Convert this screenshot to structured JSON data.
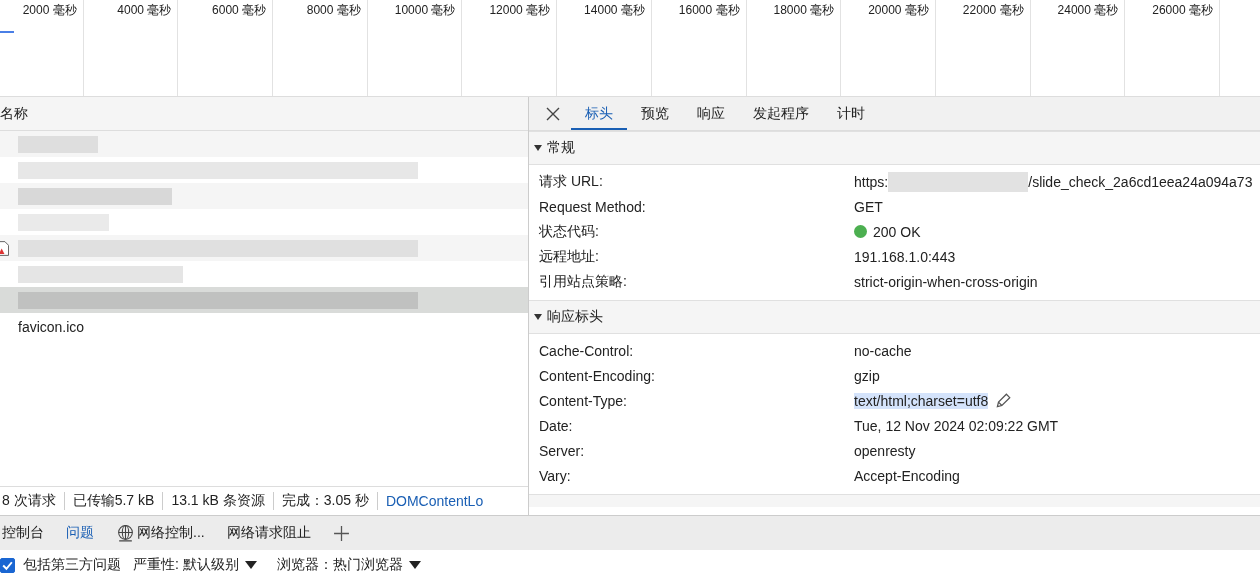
{
  "timeline": {
    "ticks": [
      "2000 毫秒",
      "4000 毫秒",
      "6000 毫秒",
      "8000 毫秒",
      "10000 毫秒",
      "12000 毫秒",
      "14000 毫秒",
      "16000 毫秒",
      "18000 毫秒",
      "20000 毫秒",
      "22000 毫秒",
      "24000 毫秒",
      "26000 毫秒"
    ]
  },
  "requests": {
    "column": "名称",
    "rows": [
      {
        "kind": "redacted",
        "selected": false
      },
      {
        "kind": "redacted",
        "selected": false
      },
      {
        "kind": "redacted",
        "selected": false
      },
      {
        "kind": "redacted",
        "selected": false
      },
      {
        "kind": "redacted_error",
        "selected": false
      },
      {
        "kind": "redacted",
        "selected": false
      },
      {
        "kind": "redacted",
        "selected": true
      },
      {
        "kind": "name",
        "name": "favicon.ico",
        "selected": false
      }
    ]
  },
  "status_bar": [
    {
      "text": "8 次请求",
      "kind": "plain"
    },
    {
      "text": "已传输5.7 kB",
      "kind": "plain"
    },
    {
      "text": "13.1 kB 条资源",
      "kind": "plain"
    },
    {
      "text": "完成：3.05 秒",
      "kind": "plain"
    },
    {
      "text": "DOMContentLo",
      "kind": "link"
    }
  ],
  "detail_tabs": [
    {
      "label": "标头",
      "selected": true
    },
    {
      "label": "预览",
      "selected": false
    },
    {
      "label": "响应",
      "selected": false
    },
    {
      "label": "发起程序",
      "selected": false
    },
    {
      "label": "计时",
      "selected": false
    }
  ],
  "sections": [
    {
      "title": "常规",
      "expanded": true,
      "rows": [
        {
          "name": "请求 URL:",
          "kind": "url",
          "value_prefix": "https:",
          "value": "/slide_check_2a6cd1eea24a094a73"
        },
        {
          "name": "Request Method:",
          "kind": "text",
          "value": "GET"
        },
        {
          "name": "状态代码:",
          "kind": "status",
          "value": "200 OK",
          "color": "#4caf50"
        },
        {
          "name": "远程地址:",
          "kind": "text",
          "value": "191.168.1.0:443"
        },
        {
          "name": "引用站点策略:",
          "kind": "text",
          "value": "strict-origin-when-cross-origin"
        }
      ]
    },
    {
      "title": "响应标头",
      "expanded": true,
      "rows": [
        {
          "name": "Cache-Control:",
          "kind": "text",
          "value": "no-cache"
        },
        {
          "name": "Content-Encoding:",
          "kind": "text",
          "value": "gzip"
        },
        {
          "name": "Content-Type:",
          "kind": "editable",
          "value": "text/html;charset=utf8"
        },
        {
          "name": "Date:",
          "kind": "text",
          "value": "Tue, 12 Nov 2024 02:09:22 GMT"
        },
        {
          "name": "Server:",
          "kind": "text",
          "value": "openresty"
        },
        {
          "name": "Vary:",
          "kind": "text",
          "value": "Accept-Encoding"
        }
      ]
    }
  ],
  "drawer_tabs": [
    {
      "label": "控制台",
      "selected": false,
      "icon": false
    },
    {
      "label": "问题",
      "selected": true,
      "icon": false
    },
    {
      "label": "网络控制...",
      "selected": false,
      "icon": true
    },
    {
      "label": "网络请求阻止",
      "selected": false,
      "icon": false
    }
  ],
  "issues_toolbar": {
    "third_party": {
      "label": "包括第三方问题",
      "checked": true
    },
    "dropdowns": [
      {
        "label": "严重性: 默认级别"
      },
      {
        "label": "浏览器：热门浏览器"
      }
    ]
  }
}
